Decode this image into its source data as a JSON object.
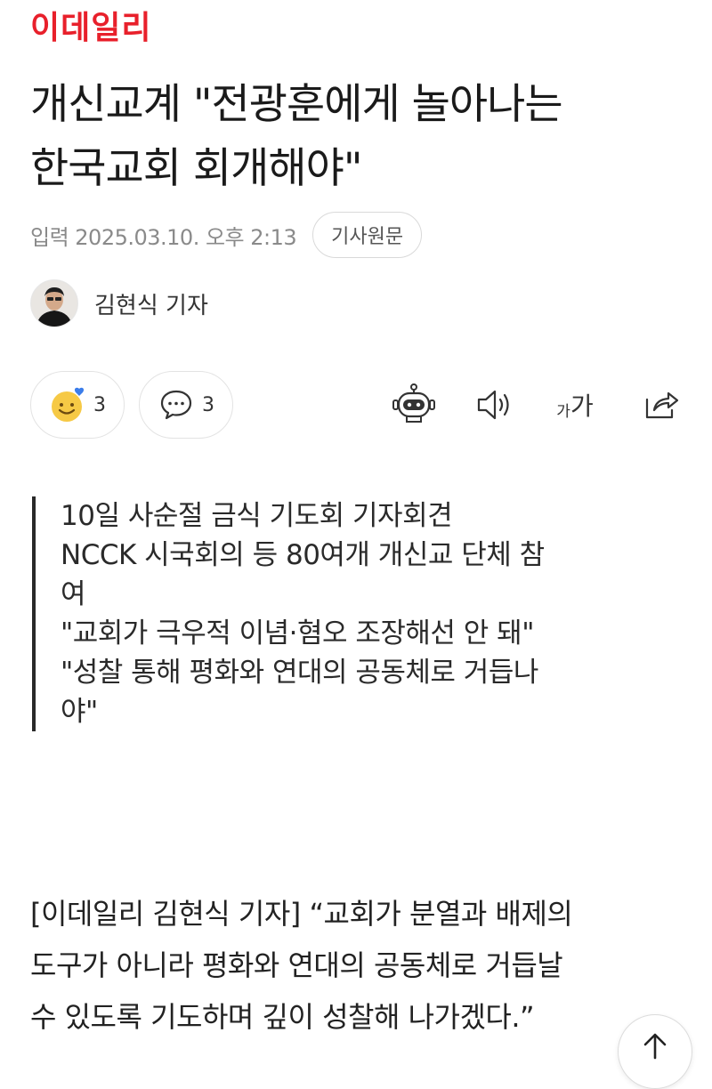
{
  "brand": {
    "logo_text": "이데일리"
  },
  "article": {
    "headline_line1": "개신교계 \"전광훈에게 놀아나는",
    "headline_line2": "한국교회 회개해야\"",
    "published_label": "입력 2025.03.10. 오후 2:13",
    "original_button": "기사원문",
    "author": "김현식 기자"
  },
  "actions": {
    "reaction_count": "3",
    "comment_count": "3",
    "font_size_label_small": "가",
    "font_size_label_large": "가"
  },
  "summary": [
    "10일 사순절 금식 기도회 기자회견",
    "NCCK 시국회의 등 80여개 개신교 단체 참",
    "여",
    "\"교회가 극우적 이념·혐오 조장해선 안 돼\"",
    "\"성찰 통해 평화와 연대의 공동체로 거듭나",
    "야\""
  ],
  "body": {
    "line1": "[이데일리 김현식 기자] “교회가 분열과 배제의",
    "line2": "도구가 아니라 평화와 연대의 공동체로 거듭날",
    "line3": "수 있도록 기도하며 깊이 성찰해 나가겠다.”"
  },
  "icons": {
    "reaction": "smile-heart-icon",
    "comment": "speech-bubble-icon",
    "summary_bot": "robot-icon",
    "tts": "speaker-icon",
    "font_size": "font-size-icon",
    "share": "share-icon",
    "scroll_top": "arrow-up-icon"
  },
  "colors": {
    "brand": "#e8202b",
    "text": "#1a1a1a",
    "meta": "#8a8a8a",
    "reaction_face": "#f6c945",
    "reaction_heart": "#3b7dea"
  }
}
